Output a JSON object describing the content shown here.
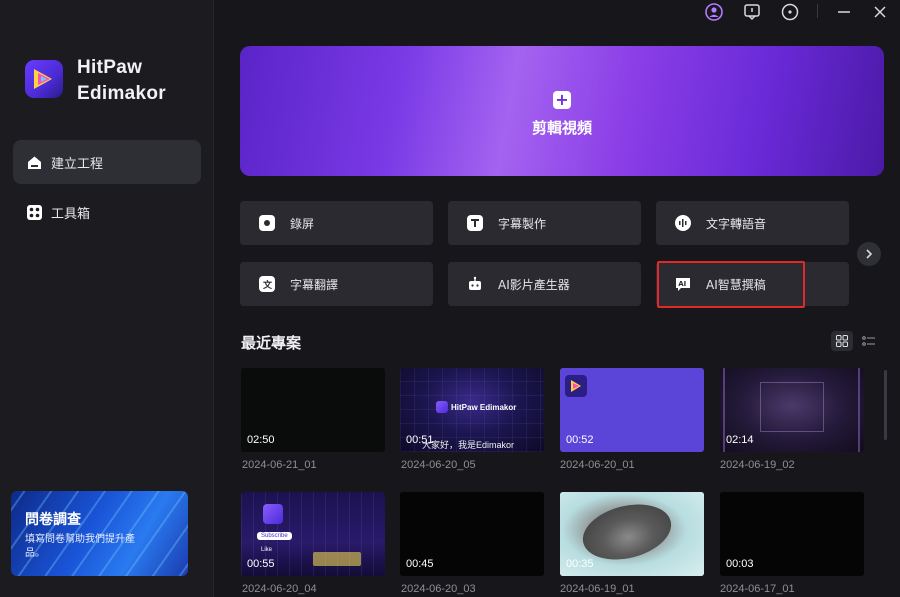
{
  "app": {
    "name_line1": "HitPaw",
    "name_line2": "Edimakor"
  },
  "sidebar": {
    "items": [
      {
        "label": "建立工程",
        "icon": "home-icon",
        "active": true
      },
      {
        "label": "工具箱",
        "icon": "toolbox-icon",
        "active": false
      }
    ],
    "survey": {
      "title": "問卷調查",
      "subtitle": "填寫問卷幫助我們提升產品。"
    }
  },
  "topbar": {
    "icons": [
      "user-icon",
      "feedback-icon",
      "info-icon",
      "minimize-icon",
      "close-icon"
    ]
  },
  "hero": {
    "label": "剪輯視頻",
    "icon": "plus-icon"
  },
  "tools": [
    {
      "label": "錄屏",
      "icon": "record-icon"
    },
    {
      "label": "字幕製作",
      "icon": "text-icon"
    },
    {
      "label": "文字轉語音",
      "icon": "tts-icon"
    },
    {
      "label": "字幕翻譯",
      "icon": "translate-icon"
    },
    {
      "label": "AI影片產生器",
      "icon": "ai-robot-icon"
    },
    {
      "label": "AI智慧撰稿",
      "icon": "ai-writer-icon",
      "highlighted": true
    }
  ],
  "recent": {
    "title": "最近專案",
    "projects": [
      {
        "name": "2024-06-21_01",
        "duration": "02:50"
      },
      {
        "name": "2024-06-20_05",
        "duration": "00:51",
        "overlay_title": "HitPaw Edimakor",
        "overlay_caption": "大家好，我是Edimakor"
      },
      {
        "name": "2024-06-20_01",
        "duration": "00:52"
      },
      {
        "name": "2024-06-19_02",
        "duration": "02:14"
      },
      {
        "name": "2024-06-20_04",
        "duration": "00:55",
        "overlay_title": "Subscribe",
        "overlay_caption": "Like"
      },
      {
        "name": "2024-06-20_03",
        "duration": "00:45"
      },
      {
        "name": "2024-06-19_01",
        "duration": "00:35"
      },
      {
        "name": "2024-06-17_01",
        "duration": "00:03"
      }
    ]
  },
  "colors": {
    "accent": "#7a3ae6",
    "highlight_border": "#e02a2a",
    "background": "#17171b",
    "card": "#2a2a30"
  }
}
